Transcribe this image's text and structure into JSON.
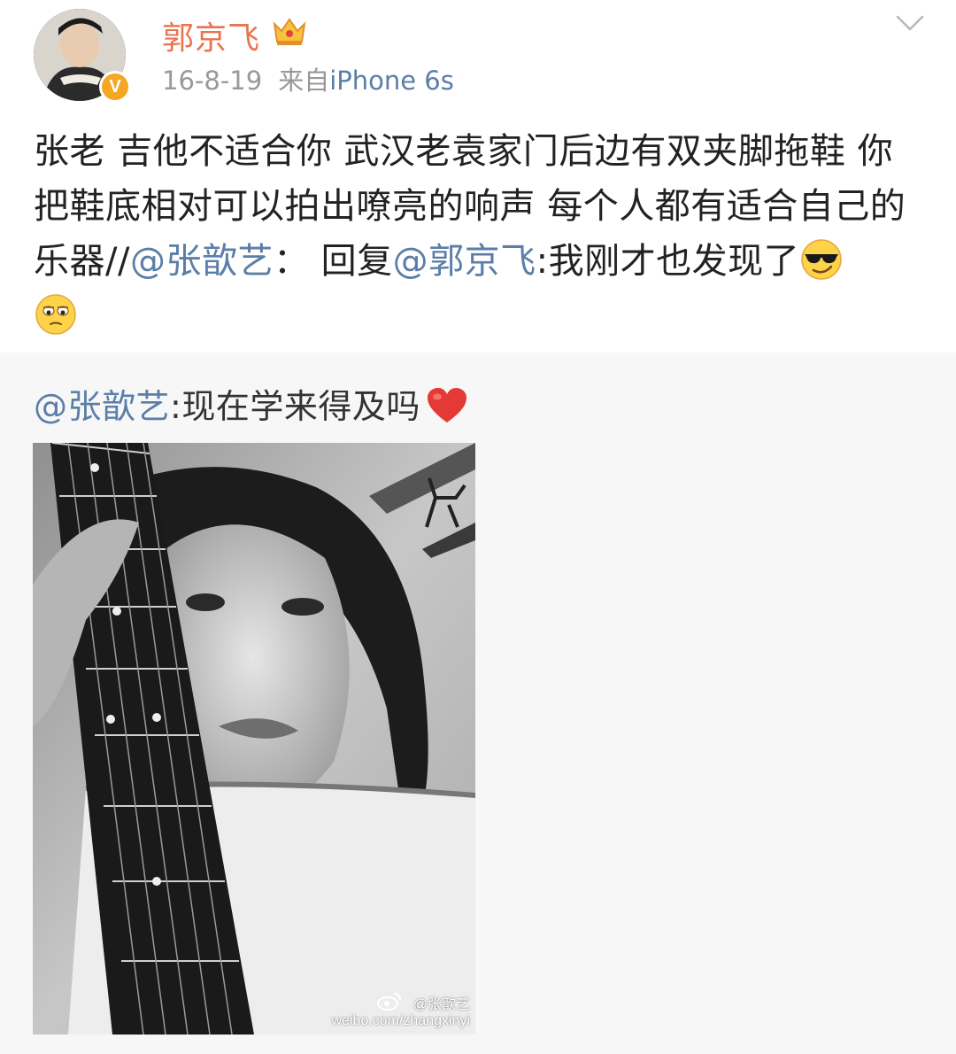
{
  "post": {
    "username": "郭京飞",
    "date": "16-8-19",
    "source_prefix": "来自",
    "device": "iPhone 6s",
    "verified_mark": "V",
    "body_part1": "张老 吉他不适合你 武汉老袁家门后边有双夹脚拖鞋 你把鞋底相对可以拍出嘹亮的响声 每个人都有适合自己的乐器//",
    "mention1": "@张歆艺",
    "body_part2": "： 回复",
    "mention2": "@郭京飞",
    "body_part3": ":我刚才也发现了"
  },
  "repost": {
    "mention": "@张歆艺",
    "text": ":现在学来得及吗",
    "watermark_name": "@张歆艺",
    "watermark_url": "weibo.com/zhangxinyi"
  },
  "icons": {
    "crown": "crown-icon",
    "chevron": "chevron-down-icon",
    "emoji1": "sunglasses-smile-emoji",
    "emoji2": "rolling-eyes-emoji",
    "heart": "red-heart-icon"
  },
  "colors": {
    "username": "#eb7350",
    "link": "#5b7ea8",
    "meta": "#999999",
    "repost_bg": "#f7f7f7",
    "verified": "#f5a623"
  }
}
